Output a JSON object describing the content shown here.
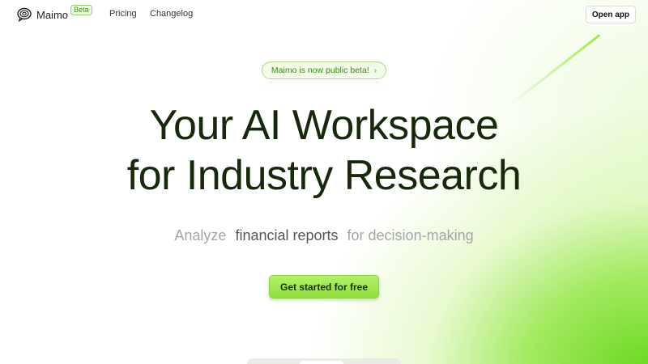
{
  "nav": {
    "brand": "Maimo",
    "beta_badge": "Beta",
    "links": [
      {
        "label": "Pricing"
      },
      {
        "label": "Changelog"
      }
    ],
    "open_app_label": "Open app"
  },
  "hero": {
    "announcement": "Maimo is now public beta!",
    "announcement_icon": "chevron-right-icon",
    "title_line1": "Your AI Workspace",
    "title_line2": "for Industry Research",
    "subtitle_prefix": "Analyze",
    "subtitle_highlight": "financial reports",
    "subtitle_suffix": "for decision-making",
    "cta_label": "Get started for free"
  },
  "colors": {
    "accent": "#8fe03a",
    "title": "#162a0b",
    "badge_text": "#3d8a12"
  }
}
